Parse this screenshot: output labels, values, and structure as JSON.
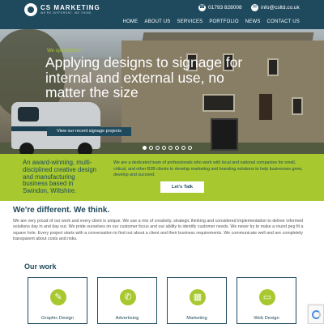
{
  "header": {
    "logo_name": "CS MARKETING",
    "logo_tagline": "WE'RE DIFFERENT. WE THINK.",
    "phone": "01793 828008",
    "email": "info@csltd.co.uk",
    "nav": [
      "HOME",
      "ABOUT US",
      "SERVICES",
      "PORTFOLIO",
      "NEWS",
      "CONTACT US"
    ]
  },
  "hero": {
    "eyebrow": "We specialise in",
    "title": "Applying designs to signage for internal and external use, no matter the size",
    "button": "View our recent signage projects",
    "slide_count": 8,
    "active_slide": 1
  },
  "intro": {
    "left": "An award-winning, multi-disciplined creative design and manufacturing business based in Swindon, Wiltshire.",
    "right": "We are a dedicated team of professionals who work with local and national companies for small, critical, and other B2B clients to develop marketing and branding solutions to help businesses grow, develop and succeed.",
    "button": "Let's Talk"
  },
  "different": {
    "title": "We're different. We think.",
    "text": "We are very proud of our work and every client is unique. We use a mix of creativity, strategic thinking and considered implementation to deliver informed solutions day in and day out. We pride ourselves on our customer focus and our ability to identify customer needs. We never try to make a round peg fit a square hole. Every project starts with a conversation to find out about a client and their business requirements. We communicate well and are completely transparent about costs and risks."
  },
  "work": {
    "title": "Our work",
    "cards": [
      {
        "label": "Graphic Design",
        "icon": "pen-icon"
      },
      {
        "label": "Advertising",
        "icon": "megaphone-icon"
      },
      {
        "label": "Marketing",
        "icon": "chart-icon"
      },
      {
        "label": "Web Design",
        "icon": "monitor-icon"
      }
    ]
  },
  "colors": {
    "navy": "#1f4a5e",
    "lime": "#a7c82e"
  }
}
